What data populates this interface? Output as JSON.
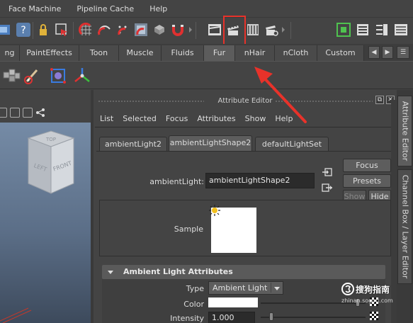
{
  "menubar": {
    "items": [
      "Face Machine",
      "Pipeline Cache",
      "Help"
    ]
  },
  "status_toolbar": {
    "icons": [
      "render-region-icon",
      "help-icon",
      "lock-icon",
      "select-snap-icon",
      "snap-curve-icon",
      "snap-point-icon",
      "snap-view-icon",
      "render-view-icon",
      "render-current-icon",
      "ipr-render-icon",
      "render-settings-icon",
      "clapper-icon",
      "clapper-film-icon",
      "clapper-settings-icon",
      "channel-toggle-icon",
      "attribute-editor-toggle-icon",
      "tool-settings-toggle-icon",
      "layer-editor-toggle-icon"
    ]
  },
  "shelf_tabs": {
    "tabs": [
      "ng",
      "PaintEffects",
      "Toon",
      "Muscle",
      "Fluids",
      "Fur",
      "nHair",
      "nCloth",
      "Custom"
    ],
    "active": "Fur"
  },
  "attribute_editor": {
    "title": "Attribute Editor",
    "menu": [
      "List",
      "Selected",
      "Focus",
      "Attributes",
      "Show",
      "Help"
    ],
    "node_tabs": [
      "ambientLight2",
      "ambientLightShape2",
      "defaultLightSet"
    ],
    "active_node_tab": "ambientLightShape2",
    "node_type_label": "ambientLight:",
    "node_name_value": "ambientLightShape2",
    "buttons": {
      "focus": "Focus",
      "presets": "Presets",
      "show": "Show",
      "hide": "Hide"
    },
    "sample_label": "Sample",
    "section_title": "Ambient Light Attributes",
    "attributes": {
      "type_label": "Type",
      "type_value": "Ambient Light",
      "color_label": "Color",
      "color_value": "#ffffff",
      "intensity_label": "Intensity",
      "intensity_value": "1.000"
    }
  },
  "viewport": {
    "cube_faces": [
      "LEFT",
      "FRONT",
      "TOP"
    ]
  },
  "side_tabs": {
    "tabs": [
      "Attribute Editor",
      "Channel Box / Layer Editor"
    ],
    "active": "Attribute Editor"
  },
  "watermark": {
    "text": "搜狗指南",
    "url": "zhinan.sogou.com"
  },
  "colors": {
    "highlight": "#e8322a",
    "panel": "#444444"
  }
}
